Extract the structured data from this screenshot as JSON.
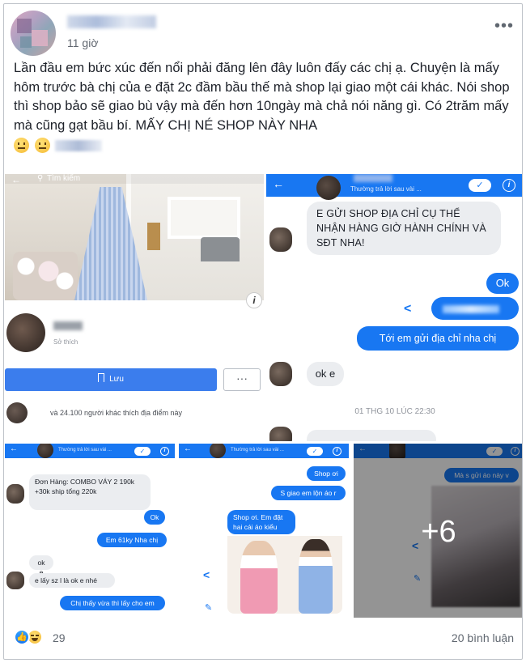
{
  "post": {
    "time": "11 giờ",
    "text": "Lần đầu em bức xúc đến nổi phải đăng lên đây luôn đấy các chị ạ. Chuyện là mấy hôm trước bà chị của e đặt 2c đầm bầu thế mà shop lại giao một cái khác. Nói shop thì shop bảo sẽ giao bù vậy mà đến hơn 10ngày mà chả nói năng gì. Có 2trăm mấy mà cũng gạt bầu bí. MẤY CHỊ NÉ SHOP NÀY NHA",
    "more_icon": "more-dots-icon"
  },
  "tile_product": {
    "search_placeholder": "Tìm kiếm",
    "subtitle": "Sở thích",
    "save_label": "Lưu",
    "more_label": "···",
    "likes_text": "và 24.100 người khác thích địa điểm này"
  },
  "tile_chat_main": {
    "header_sub": "Thường trả lời sau vài ...",
    "messages": [
      "E GỬI SHOP ĐỊA CHỈ CỤ THỂ NHẬN HÀNG GIỜ HÀNH CHÍNH VÀ SĐT NHA!",
      "Ok",
      "Tới em gửi địa chỉ nha chị",
      "ok e"
    ],
    "timestamp": "01 THG 10 LÚC 22:30"
  },
  "tile_chat_2": {
    "header_sub": "Thường trả lời sau vài ...",
    "messages": [
      "Đơn Hàng: COMBO VÁY 2 190k +30k ship tổng 220k",
      "Ok",
      "Em 61ky Nha chị",
      "ok e",
      "e lấy sz l là ok e nhé",
      "Chị thấy vừa thì lấy cho em"
    ]
  },
  "tile_chat_3": {
    "header_sub": "Thường trả lời sau vài ...",
    "messages": [
      "Shop ơi",
      "S giao em lộn áo r",
      "Shop ơi. Em đặt hai cái áo kiểu này"
    ]
  },
  "tile_chat_4": {
    "messages": [
      "Mà s gửi áo này v"
    ],
    "more_count": "+6"
  },
  "footer": {
    "reaction_count": "29",
    "comments": "20 bình luận"
  },
  "colors": {
    "messenger_blue": "#1877f2",
    "bubble_gray": "#ebedf0",
    "text_dark": "#1d2129",
    "text_muted": "#606770"
  }
}
